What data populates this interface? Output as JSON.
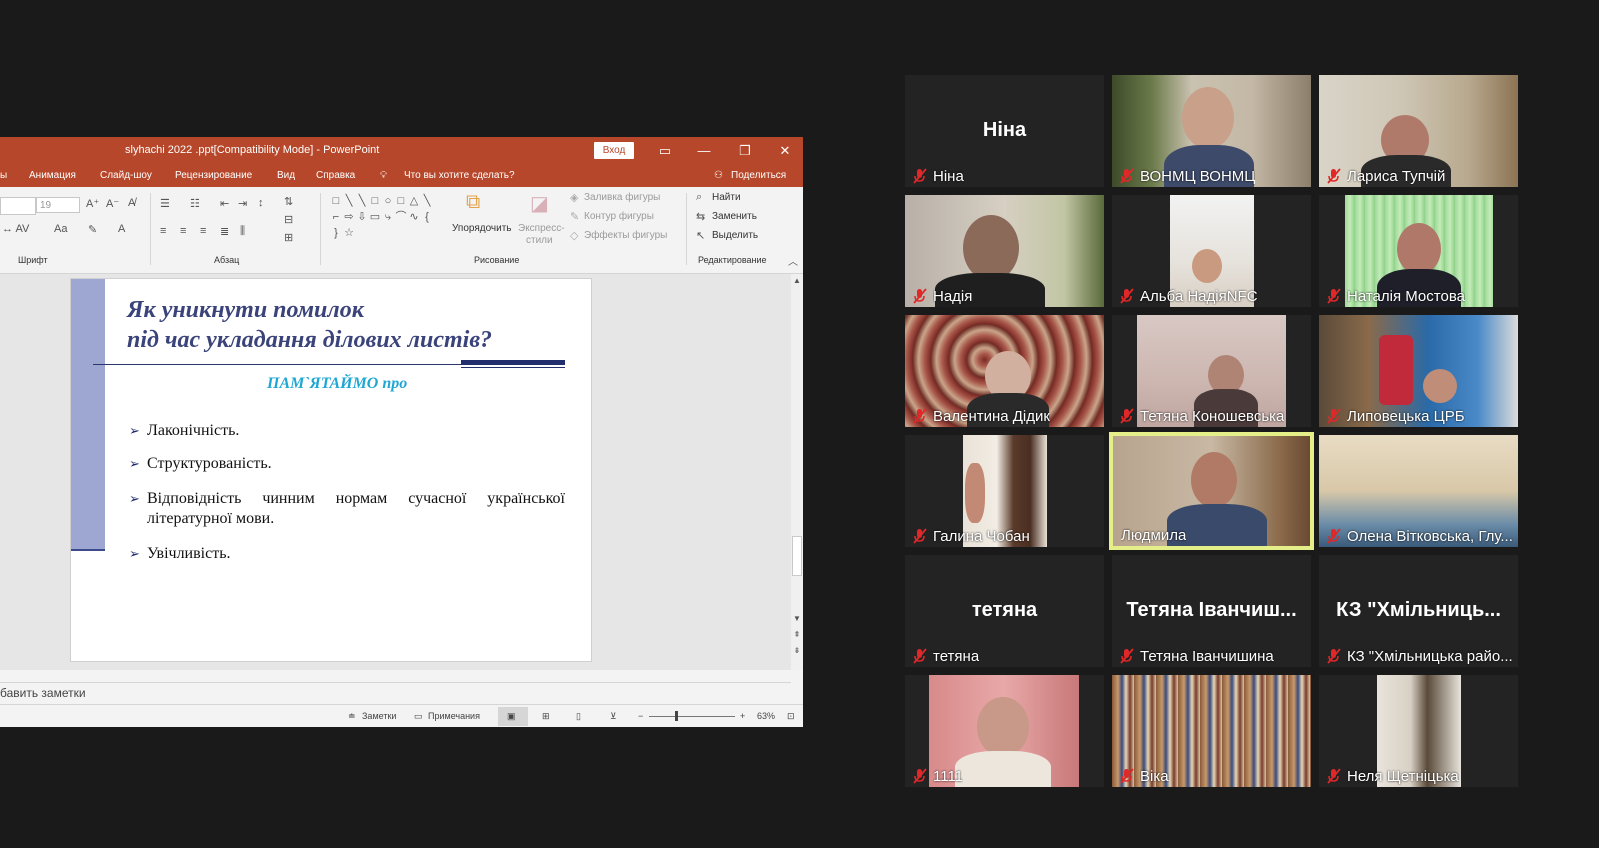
{
  "powerpoint": {
    "title": "slyhachi 2022 .ppt[Compatibility Mode]  -  PowerPoint",
    "sign_in": "Вход",
    "tabs": [
      "ы",
      "Анимация",
      "Слайд-шоу",
      "Рецензирование",
      "Вид",
      "Справка"
    ],
    "tell_me": "Что вы хотите сделать?",
    "share": "Поделиться",
    "ribbon": {
      "font_size": "19",
      "arrange": "Упорядочить",
      "quick_styles_1": "Экспресс-",
      "quick_styles_2": "стили",
      "shape_fill": "Заливка фигуры",
      "shape_outline": "Контур фигуры",
      "shape_effects": "Эффекты фигуры",
      "find": "Найти",
      "replace": "Заменить",
      "select": "Выделить",
      "groups": {
        "font": "Шрифт",
        "paragraph": "Абзац",
        "drawing": "Рисование",
        "editing": "Редактирование"
      }
    },
    "slide": {
      "title_line1": "Як уникнути помилок",
      "title_line2": "під час укладання ділових листів?",
      "subtitle": "ПАМ`ЯТАЙМО про",
      "bullets": [
        "Лаконічність.",
        "Структурованість.",
        "Відповідність чинним нормам сучасної української літературної мови.",
        "Увічливість."
      ]
    },
    "notes_placeholder": "бавить заметки",
    "status": {
      "notes": "Заметки",
      "comments": "Примечания",
      "zoom": "63%"
    }
  },
  "participants": [
    {
      "name": "Ніна",
      "display": "Ніна",
      "muted": true
    },
    {
      "name": "ВОНМЦ ВОНМЦ",
      "muted": true
    },
    {
      "name": "Лариса Тупчій",
      "muted": true
    },
    {
      "name": "Надія",
      "muted": true
    },
    {
      "name": "Альба НадіяNFC",
      "muted": true
    },
    {
      "name": "Наталія Мостова",
      "muted": true
    },
    {
      "name": "Валентина Дідик",
      "muted": true
    },
    {
      "name": "Тетяна Коношевська",
      "muted": true
    },
    {
      "name": "Липовецька ЦРБ",
      "muted": true
    },
    {
      "name": "Галина  Чобан",
      "muted": true
    },
    {
      "name": "Людмила",
      "muted": false,
      "active": true
    },
    {
      "name": "Олена Вітковська, Глу...",
      "muted": true
    },
    {
      "name": "тетяна",
      "display": "тетяна",
      "muted": true
    },
    {
      "name": "Тетяна Іванчишина",
      "display": "Тетяна Іванчиш...",
      "muted": true
    },
    {
      "name": "КЗ \"Хмільницька райо...",
      "display": "КЗ \"Хмільниць...",
      "muted": true
    },
    {
      "name": "1111",
      "muted": true
    },
    {
      "name": "Віка",
      "muted": true
    },
    {
      "name": "Неля Щетніцька",
      "muted": true
    }
  ],
  "colors": {
    "ppt_accent": "#b7472a",
    "active_speaker": "#e5ef8a",
    "mute": "#e02828"
  }
}
